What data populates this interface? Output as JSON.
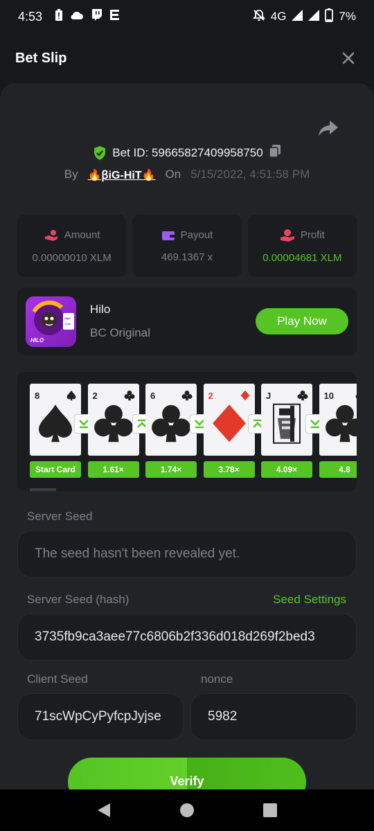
{
  "status": {
    "time": "4:53",
    "network": "4G",
    "battery": "7%"
  },
  "header": {
    "title": "Bet Slip"
  },
  "bet": {
    "id_label": "Bet ID: 59665827409958750",
    "by_label": "By",
    "user": "🔥ꞵiG-HiT🔥",
    "on_label": "On",
    "date": "5/15/2022, 4:51:58 PM"
  },
  "stats": {
    "amount_label": "Amount",
    "amount_value": "0.00000010 XLM",
    "payout_label": "Payout",
    "payout_value": "469.1367 x",
    "profit_label": "Profit",
    "profit_value": "0.00004681 XLM"
  },
  "game": {
    "name": "Hilo",
    "subtitle": "BC Original",
    "logo_text": "HILO",
    "badge_high": "High",
    "badge_low": "Low",
    "play_label": "Play Now"
  },
  "cards": [
    {
      "rank": "8",
      "suit": "spade",
      "mult": "Start Card"
    },
    {
      "rank": "2",
      "suit": "club",
      "mult": "1.61×"
    },
    {
      "rank": "6",
      "suit": "club",
      "mult": "1.74×"
    },
    {
      "rank": "2",
      "suit": "diamond",
      "mult": "3.78×"
    },
    {
      "rank": "J",
      "suit": "club",
      "mult": "4.09×"
    },
    {
      "rank": "10",
      "suit": "club",
      "mult": "4.8"
    }
  ],
  "seeds": {
    "server_label": "Server Seed",
    "server_placeholder": "The seed hasn't been revealed yet.",
    "hash_label": "Server Seed (hash)",
    "settings_link": "Seed Settings",
    "hash_value": "3735fb9ca3aee77c6806b2f336d018d269f2bed3",
    "client_label": "Client Seed",
    "client_value": "71scWpCyPyfcpJyjse",
    "nonce_label": "nonce",
    "nonce_value": "5982"
  },
  "verify_label": "Verify",
  "colors": {
    "accent": "#55c424",
    "background": "#17181b",
    "panel": "#222326",
    "card": "#1b1c1f"
  }
}
